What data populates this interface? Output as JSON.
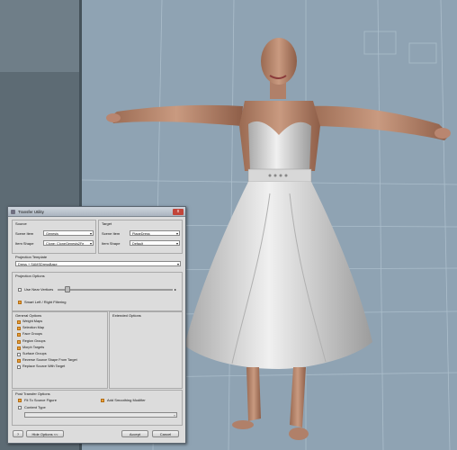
{
  "dialog": {
    "title": "Transfer Utility",
    "close_label": "x",
    "source": {
      "heading": "Source",
      "scene_item_label": "Scene Item",
      "scene_item_value": "Genesis",
      "item_shape_label": "Item Shape",
      "item_shape_value": "Clone: CloneGenesis2Fe"
    },
    "target": {
      "heading": "Target",
      "scene_item_label": "Scene Item",
      "scene_item_value": "PlageDress",
      "item_shape_label": "Item Shape",
      "item_shape_value": "Default"
    },
    "projection_template": {
      "heading": "Projection Template",
      "value": "Dress + SAMSDressBase"
    },
    "projection_options": {
      "heading": "Projection Options",
      "use_near_vertices": "Use Near Vertices",
      "smart_filtering": "Smart Left / Right Filtering"
    },
    "general_options": {
      "heading": "General Options",
      "items": [
        {
          "label": "Weight Maps",
          "checked": true
        },
        {
          "label": "Selection Map",
          "checked": true
        },
        {
          "label": "Face Groups",
          "checked": true
        },
        {
          "label": "Region Groups",
          "checked": true
        },
        {
          "label": "Morph Targets",
          "checked": true
        },
        {
          "label": "Surface Groups",
          "checked": false
        },
        {
          "label": "Reverse Source Shape From Target",
          "checked": true
        },
        {
          "label": "Replace Source With Target",
          "checked": false
        }
      ]
    },
    "extended_options": {
      "heading": "Extended Options"
    },
    "post_transfer": {
      "heading": "Post Transfer Options",
      "fit_to_source": "Fit To Source Figure",
      "add_smoothing": "Add Smoothing Modifier",
      "content_type": "Content Type"
    },
    "buttons": {
      "help": "?",
      "hide_options": "Hide Options <<",
      "accept": "Accept",
      "cancel": "Cancel"
    }
  },
  "colors": {
    "viewport_bg": "#8fa3b3",
    "left_panel": "#5d6b74",
    "checkbox_on": "#e8a03a"
  }
}
